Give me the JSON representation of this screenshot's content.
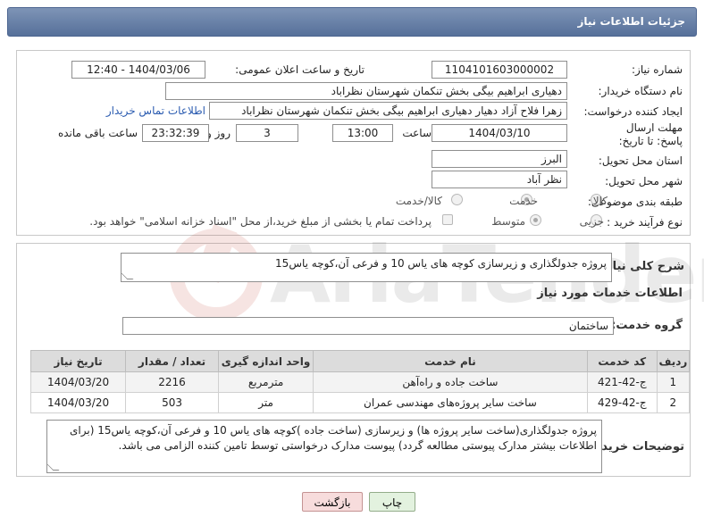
{
  "header": {
    "title": "جزئیات اطلاعات نیاز"
  },
  "form": {
    "need_number": {
      "label": "شماره نیاز:",
      "value": "1104101603000002"
    },
    "announce_datetime": {
      "label": "تاریخ و ساعت اعلان عمومی:",
      "value": "1404/03/06 - 12:40"
    },
    "buyer_org": {
      "label": "نام دستگاه خریدار:",
      "value": "دهیاری ابراهیم بیگی بخش تنکمان شهرستان نظراباد"
    },
    "requester": {
      "label": "ایجاد کننده درخواست:",
      "value": "زهرا فلاح آزاد دهیار دهیاری ابراهیم بیگی بخش تنکمان شهرستان نظراباد",
      "contact_link": "اطلاعات تماس خریدار"
    },
    "deadline": {
      "label": "مهلت ارسال پاسخ: تا تاریخ:",
      "date": "1404/03/10",
      "time_label": "ساعت",
      "time": "13:00",
      "days": "3",
      "days_label": "روز و",
      "remaining": "23:32:39",
      "remaining_label": "ساعت باقی مانده"
    },
    "province": {
      "label": "استان محل تحویل:",
      "value": "البرز"
    },
    "city": {
      "label": "شهر محل تحویل:",
      "value": "نظر آباد"
    },
    "category": {
      "label": "طبقه بندی موضوعی:",
      "options": [
        "کالا",
        "خدمت",
        "کالا/خدمت"
      ],
      "selected": "خدمت"
    },
    "purchase_type": {
      "label": "نوع فرآیند خرید :",
      "options": [
        "جزیی",
        "متوسط"
      ],
      "selected": "متوسط",
      "payment_note": "پرداخت تمام یا بخشی از مبلغ خرید،از محل \"اسناد خزانه اسلامی\" خواهد بود."
    }
  },
  "need_summary": {
    "label": "شرح کلی نیاز:",
    "value": "پروژه جدولگذاری و زیرسازی کوچه های یاس 10 و فرعی آن،کوچه یاس15"
  },
  "services": {
    "title": "اطلاعات خدمات مورد نیاز",
    "group_label": "گروه خدمت:",
    "group_value": "ساختمان",
    "columns": [
      "ردیف",
      "کد خدمت",
      "نام خدمت",
      "واحد اندازه گیری",
      "تعداد / مقدار",
      "تاریخ نیاز"
    ],
    "rows": [
      {
        "row": "1",
        "code": "ج-42-421",
        "name": "ساخت جاده و راه‌آهن",
        "unit": "مترمربع",
        "qty": "2216",
        "date": "1404/03/20"
      },
      {
        "row": "2",
        "code": "ج-42-429",
        "name": "ساخت سایر پروژه‌های مهندسی عمران",
        "unit": "متر",
        "qty": "503",
        "date": "1404/03/20"
      }
    ]
  },
  "buyer_notes": {
    "label": "توضیحات خریدار:",
    "value": "پروژه جدولگذاری(ساخت سایر پروژه ها) و زیرسازی (ساخت جاده )کوچه های یاس 10 و فرعی آن،کوچه یاس15 (برای اطلاعات بیشتر مدارک پیوستی مطالعه گردد) پیوست مدارک درخواستی توسط تامین کننده الزامی می باشد."
  },
  "buttons": {
    "back": "بازگشت",
    "print": "چاپ"
  },
  "watermark": {
    "text": "AriaTender.neT"
  },
  "colors": {
    "header_bg": "#6a82aa",
    "link": "#2a5bb0",
    "back_bg": "#f7dcdc",
    "print_bg": "#e3f2df"
  }
}
